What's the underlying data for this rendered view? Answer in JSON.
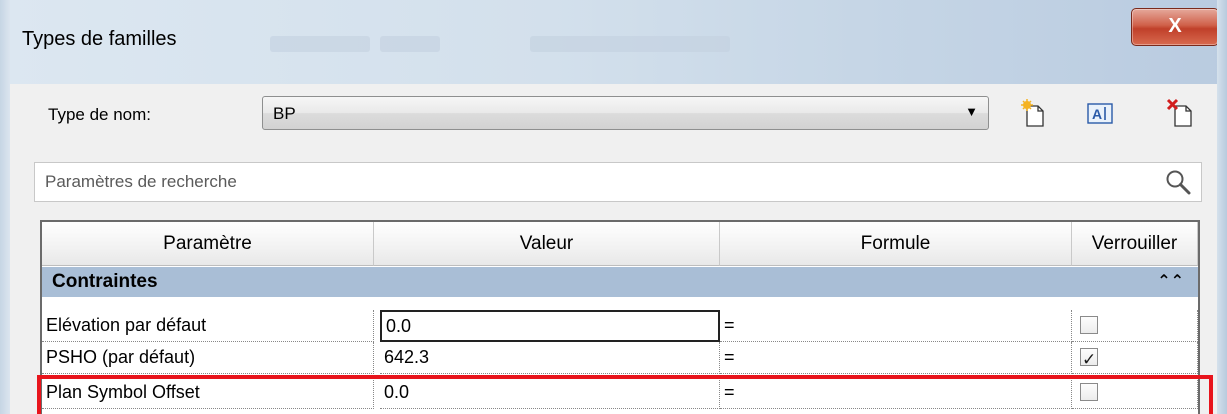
{
  "window": {
    "title": "Types de familles",
    "close_label": "X"
  },
  "type_row": {
    "label": "Type de nom:",
    "selected_value": "BP",
    "icons": [
      "new-type-icon",
      "rename-type-icon",
      "delete-type-icon"
    ]
  },
  "search": {
    "placeholder": "Paramètres de recherche",
    "value": ""
  },
  "table": {
    "columns": [
      "Paramètre",
      "Valeur",
      "Formule",
      "Verrouiller"
    ],
    "group": {
      "name": "Contraintes",
      "collapse_glyph": "⌃"
    },
    "rows": [
      {
        "param": "Elévation par défaut",
        "value": "0.0",
        "formula": "=",
        "locked": false
      },
      {
        "param": "PSHO (par défaut)",
        "value": "642.3",
        "formula": "=",
        "locked": true
      },
      {
        "param": "Plan Symbol Offset",
        "value": "0.0",
        "formula": "=",
        "locked": false
      }
    ]
  },
  "colors": {
    "group_header": "#a9bed6",
    "highlight": "#e8141c",
    "close_button": "#c0402a"
  }
}
